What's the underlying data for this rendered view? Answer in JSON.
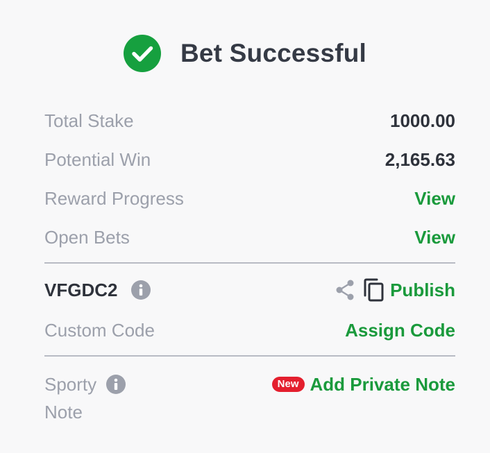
{
  "header": {
    "title": "Bet Successful",
    "icon": "check-circle-icon",
    "icon_color": "#16a03f"
  },
  "summary": {
    "total_stake": {
      "label": "Total Stake",
      "value": "1000.00"
    },
    "potential_win": {
      "label": "Potential Win",
      "value": "2,165.63"
    },
    "reward_progress": {
      "label": "Reward Progress",
      "action": "View"
    },
    "open_bets": {
      "label": "Open Bets",
      "action": "View"
    }
  },
  "booking": {
    "code": "VFGDC2",
    "info_icon": "info-icon",
    "share_icon": "share-icon",
    "copy_icon": "copy-icon",
    "publish_label": "Publish",
    "custom_code_label": "Custom Code",
    "assign_code_label": "Assign Code"
  },
  "note": {
    "label_line1": "Sporty",
    "label_line2": "Note",
    "badge": "New",
    "badge_color": "#e41f2e",
    "action": "Add Private Note"
  },
  "colors": {
    "accent_green": "#1a9a3c",
    "label_gray": "#9ca0ab",
    "value_dark": "#2e323b",
    "background": "#f8f8f9"
  }
}
